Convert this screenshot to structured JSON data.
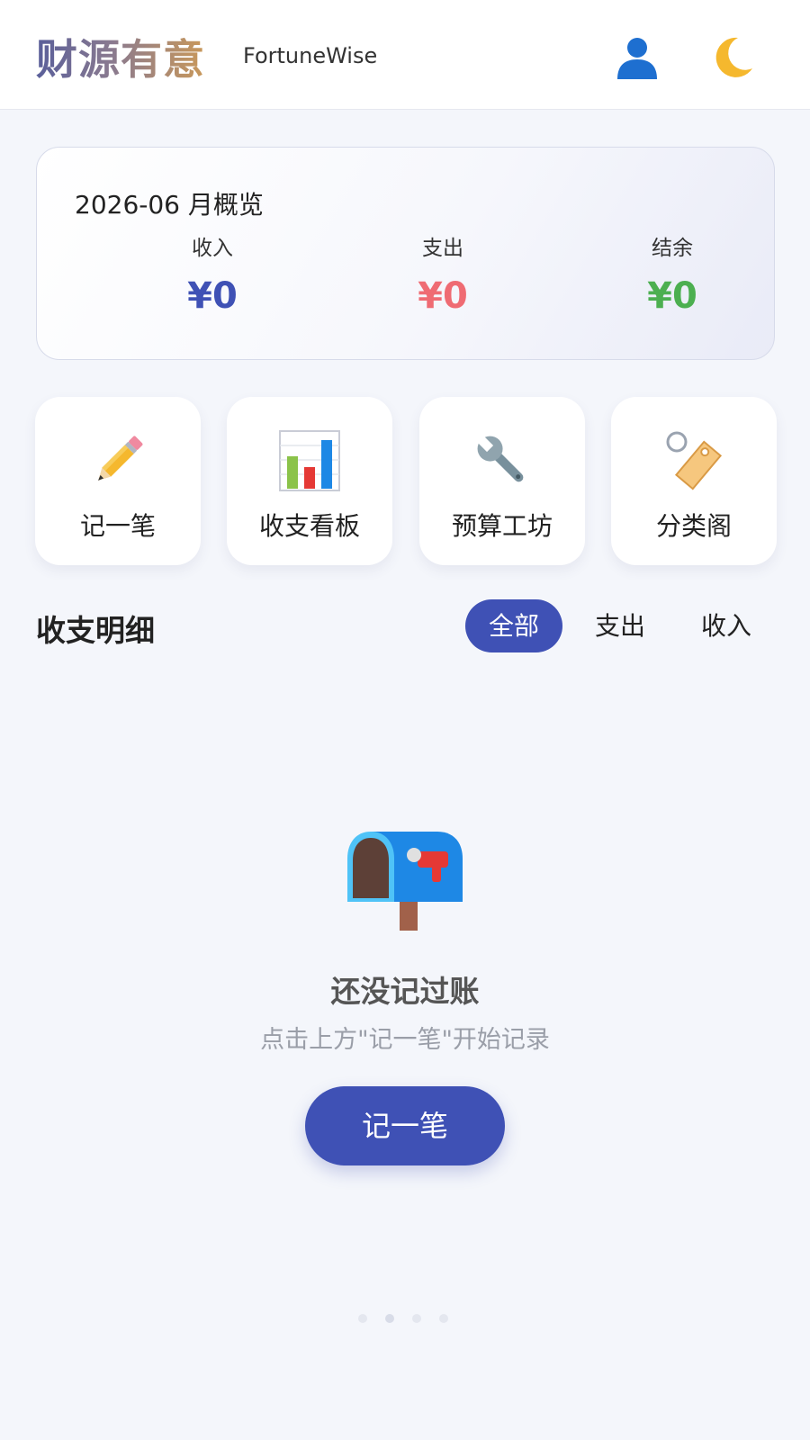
{
  "header": {
    "title": "财源有意",
    "subtitle": "FortuneWise",
    "user_icon": "user-icon",
    "theme_icon": "moon-icon"
  },
  "overview": {
    "title": "2026-06 月概览",
    "income_label": "收入",
    "income_value": "¥0",
    "expense_label": "支出",
    "expense_value": "¥0",
    "balance_label": "结余",
    "balance_value": "¥0"
  },
  "quick_actions": [
    {
      "label": "记一笔",
      "icon": "pencil-icon"
    },
    {
      "label": "收支看板",
      "icon": "bar-chart-icon"
    },
    {
      "label": "预算工坊",
      "icon": "wrench-icon"
    },
    {
      "label": "分类阁",
      "icon": "tag-icon"
    }
  ],
  "transactions": {
    "title": "收支明细",
    "filters": [
      "全部",
      "支出",
      "收入"
    ],
    "active_filter": "全部"
  },
  "empty_state": {
    "icon": "mailbox-icon",
    "title": "还没记过账",
    "subtitle": "点击上方\"记一笔\"开始记录",
    "button_label": "记一笔"
  },
  "colors": {
    "primary": "#3f51b5",
    "income": "#3f51b5",
    "expense": "#ef6b73",
    "balance": "#4caf50"
  }
}
